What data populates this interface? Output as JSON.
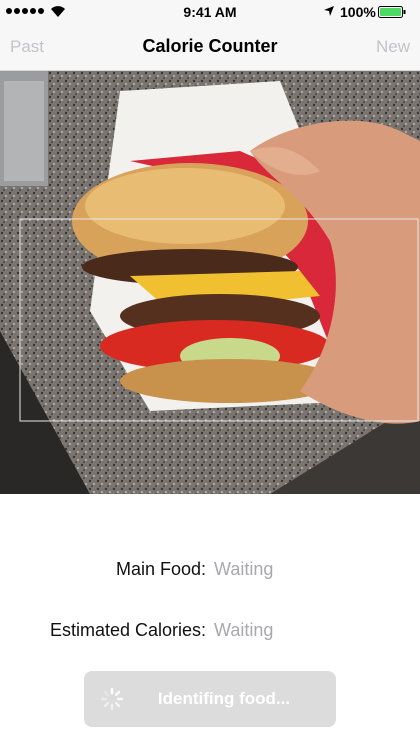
{
  "status_bar": {
    "time": "9:41 AM",
    "battery": "100%",
    "icons": [
      "signal-dots-icon",
      "wifi-icon",
      "location-arrow-icon",
      "battery-icon"
    ]
  },
  "nav": {
    "left": "Past",
    "title": "Calorie Counter",
    "right": "New"
  },
  "camera": {
    "icon": "camera-preview"
  },
  "info": {
    "main_food_label": "Main Food:",
    "main_food_value": "Waiting",
    "calories_label": "Estimated Calories:",
    "calories_value": "Waiting"
  },
  "identify_button": {
    "label": "Identifing food...",
    "icon": "spinner-icon"
  },
  "colors": {
    "nav_disabled": "#c4c4c8",
    "value_placeholder": "#a8a8ad",
    "button_bg": "#dcdcdc"
  }
}
